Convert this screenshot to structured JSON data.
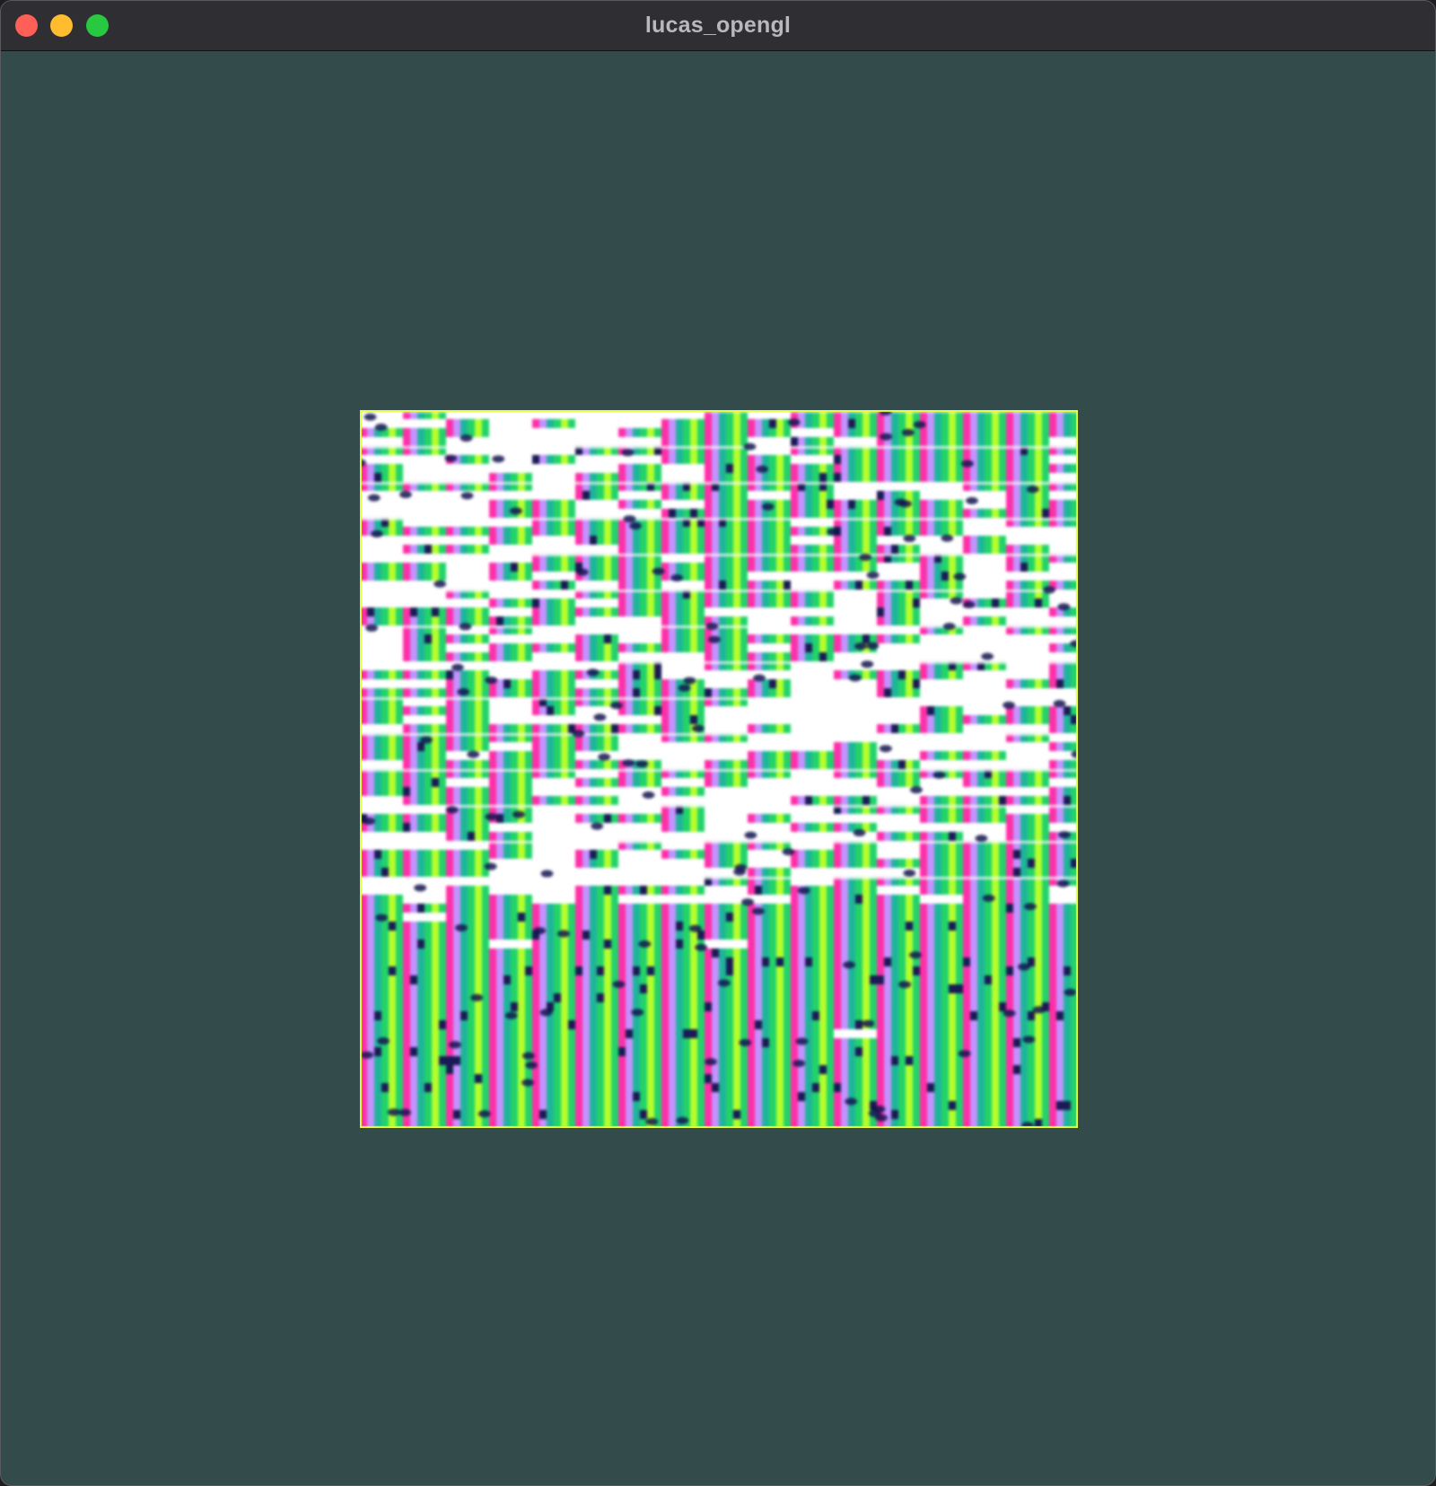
{
  "window": {
    "title": "lucas_opengl",
    "controls": {
      "close": {
        "icon": "close-icon",
        "color": "#fe5f57"
      },
      "minimize": {
        "icon": "minimize-icon",
        "color": "#febc2e"
      },
      "zoom": {
        "icon": "zoom-icon",
        "color": "#28c840"
      }
    }
  },
  "viewport": {
    "clear_color": "#344b4c",
    "quad": {
      "description_icon": "rendered-texture-quad",
      "palette": {
        "magenta": "#ff2fa8",
        "green": "#22d36a",
        "lilac": "#c493ff",
        "lime": "#b5ff2e",
        "teal": "#1fb59a",
        "white": "#ffffff",
        "navy": "#1a1a55",
        "edge": "#e8ff3a"
      }
    }
  }
}
